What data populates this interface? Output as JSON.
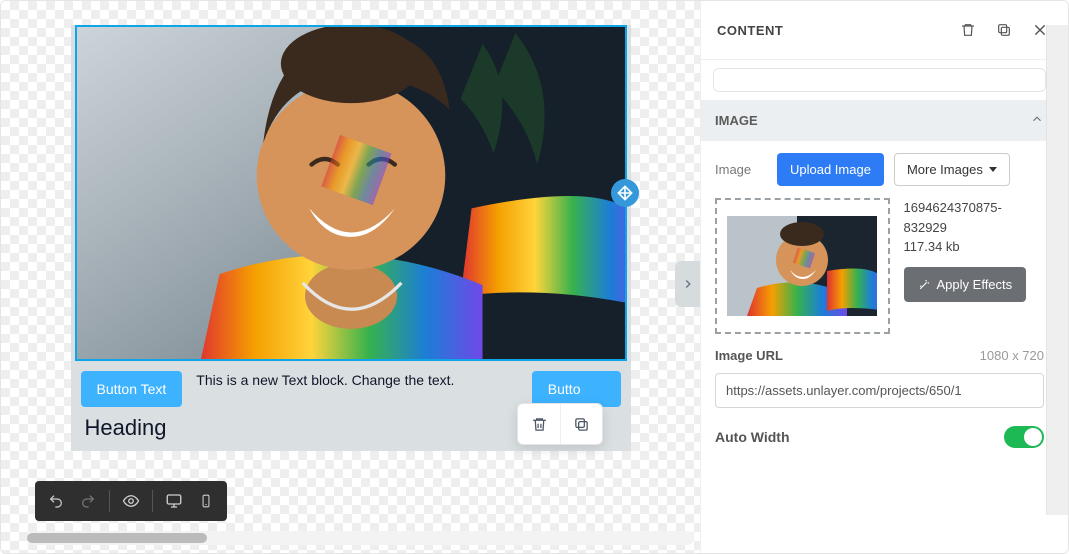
{
  "sidebar": {
    "title": "CONTENT",
    "section_image": "IMAGE",
    "image_label": "Image",
    "upload_button": "Upload Image",
    "more_images": "More Images",
    "file_name": "1694624370875-832929",
    "file_size": "117.34 kb",
    "apply_effects": "Apply Effects",
    "url_label": "Image URL",
    "url_dimensions": "1080 x 720",
    "url_value": "https://assets.unlayer.com/projects/650/1",
    "auto_width_label": "Auto Width",
    "auto_width_on": true
  },
  "canvas": {
    "button_a": "Button Text",
    "text_block": "This is a new Text block. Change the text.",
    "button_b": "Butto",
    "heading": "Heading"
  }
}
